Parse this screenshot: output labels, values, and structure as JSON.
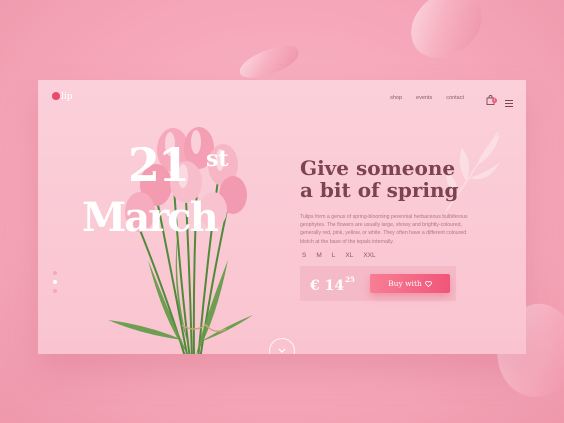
{
  "brand": {
    "name": "Tulip",
    "logo_suffix": "lip"
  },
  "nav": {
    "items": [
      "shop",
      "events",
      "contact"
    ],
    "cart_count": "1"
  },
  "hero": {
    "date_day": "21",
    "date_suffix": "st",
    "date_month": "March",
    "headline_line1": "Give someone",
    "headline_line2": "a bit of spring",
    "description": "Tulips form a genus of spring-blooming perennial herbaceous bulbiferous geophytes. The flowers are usually large, showy and brightly-coloured, generally red, pink, yellow, or white. They often have a different coloured blotch at the base of the tepals internally."
  },
  "sizes": [
    "S",
    "M",
    "L",
    "XL",
    "XXL"
  ],
  "purchase": {
    "currency": "€",
    "price_whole": "14",
    "price_cents": "25",
    "buy_label": "Buy with"
  },
  "slider": {
    "count": 3,
    "active_index": 1
  },
  "colors": {
    "background": "#f5a6b8",
    "card": "#fbd0da",
    "accent": "#f1557a",
    "headline": "#7d4450"
  },
  "icons": [
    "bag-icon",
    "menu-icon",
    "heart-icon",
    "chevron-down-icon",
    "leaf-icon"
  ]
}
